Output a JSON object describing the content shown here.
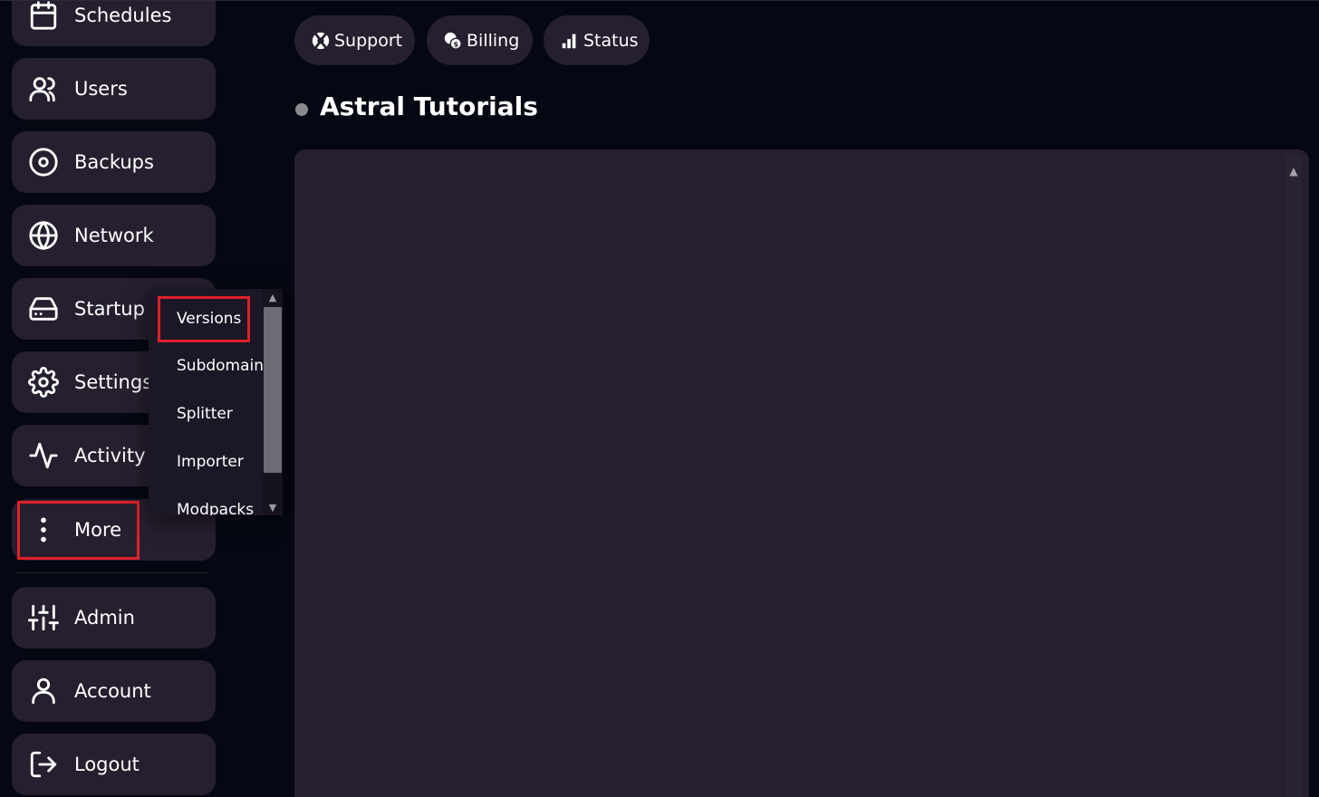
{
  "sidebar": {
    "items": [
      {
        "label": "Schedules",
        "icon": "calendar-icon"
      },
      {
        "label": "Users",
        "icon": "users-icon"
      },
      {
        "label": "Backups",
        "icon": "disc-icon"
      },
      {
        "label": "Network",
        "icon": "globe-icon"
      },
      {
        "label": "Startup",
        "icon": "hard-drive-icon"
      },
      {
        "label": "Settings",
        "icon": "gear-icon"
      },
      {
        "label": "Activity",
        "icon": "activity-icon"
      },
      {
        "label": "More",
        "icon": "more-vertical-icon"
      },
      {
        "label": "Admin",
        "icon": "sliders-icon"
      },
      {
        "label": "Account",
        "icon": "user-icon"
      },
      {
        "label": "Logout",
        "icon": "logout-icon"
      }
    ]
  },
  "more_menu": {
    "items": [
      "Versions",
      "Subdomain",
      "Splitter",
      "Importer",
      "Modpacks"
    ],
    "scroll_up": "▲",
    "scroll_down": "▼"
  },
  "top_links": [
    {
      "label": "Support",
      "icon": "lifebuoy-icon"
    },
    {
      "label": "Billing",
      "icon": "coins-icon"
    },
    {
      "label": "Status",
      "icon": "signal-bars-icon"
    }
  ],
  "server": {
    "name": "Astral Tutorials",
    "status_color": "#8a8a8e"
  },
  "console": {
    "scroll_up": "▲"
  },
  "colors": {
    "background": "#050812",
    "panel": "#261f2f",
    "highlight": "#e0202a"
  }
}
